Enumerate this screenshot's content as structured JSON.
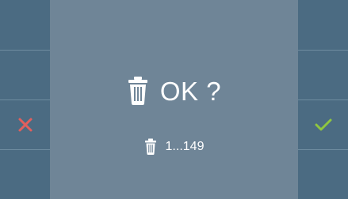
{
  "dialog": {
    "title": "OK ?",
    "range": "1...149"
  },
  "icons": {
    "delete_main": "trash-icon",
    "delete_small": "trash-icon",
    "cancel": "close-icon",
    "confirm": "check-icon"
  },
  "colors": {
    "background": "#6f8597",
    "side_panels": "#4b6b82",
    "cancel_icon": "#e25f5d",
    "confirm_icon": "#8fc63f",
    "text": "#ffffff"
  }
}
